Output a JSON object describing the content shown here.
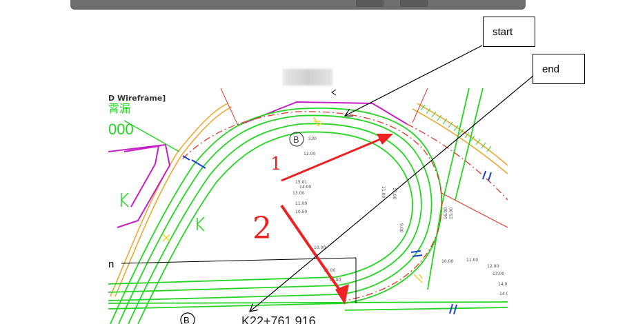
{
  "viewport_label": "D Wireframe]",
  "callouts": {
    "start_label": "start",
    "end_label": "end"
  },
  "annotations": {
    "handwritten_1": "1",
    "handwritten_2": "2"
  },
  "partial_labels": {
    "left_chinese": "霄漏",
    "left_numeric": "000",
    "bottom_circle": "B",
    "bottom_chainage": "K22+761.916",
    "left_cut": "n"
  },
  "point_markers": {
    "b_label": "B",
    "b_value": "3.00"
  },
  "elevations": [
    "12.00",
    "15.01",
    "14.00",
    "13.00",
    "11.00",
    "10.50",
    "10.00",
    "12.00",
    "13.00",
    "10.00",
    "11.00",
    "12.00",
    "13.00",
    "14.0",
    "14.00",
    "11.00",
    "9.00",
    "16.00",
    "15.00",
    "17.00"
  ],
  "colors": {
    "road_green": "#22d61f",
    "centerline_red": "#e5332a",
    "magenta": "#c61fc6",
    "orange": "#f2a020",
    "blue": "#1b3fd6",
    "arrow_red": "#ee2222"
  }
}
